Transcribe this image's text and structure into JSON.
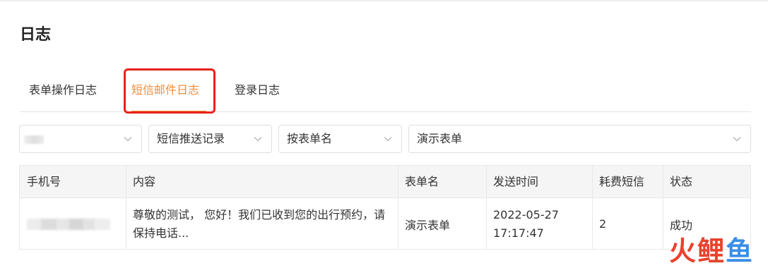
{
  "page": {
    "title": "日志"
  },
  "tabs": [
    {
      "label": "表单操作日志",
      "active": false
    },
    {
      "label": "短信邮件日志",
      "active": true
    },
    {
      "label": "登录日志",
      "active": false
    }
  ],
  "filters": {
    "select1": {
      "value": ""
    },
    "select2": {
      "value": "短信推送记录"
    },
    "select3": {
      "value": "按表单名"
    },
    "select4": {
      "value": "演示表单"
    }
  },
  "table": {
    "columns": [
      "手机号",
      "内容",
      "表单名",
      "发送时间",
      "耗费短信",
      "状态"
    ],
    "rows": [
      {
        "phone": "",
        "content": "尊敬的测试， 您好！我们已收到您的出行预约，请保持电话...",
        "form_name": "演示表单",
        "send_date": "2022-05-27",
        "send_time": "17:17:47",
        "sms_used": "2",
        "status": "成功"
      }
    ]
  },
  "watermark": {
    "text": "火鲤鱼"
  },
  "colors": {
    "accent": "#f08c3c",
    "highlight": "#e8221b",
    "header_bg": "#f5f5f5",
    "watermark_red": "#e8432e",
    "watermark_blue": "#3a8ee6"
  },
  "icons": {
    "select_arrow": "chevron-down-icon"
  }
}
